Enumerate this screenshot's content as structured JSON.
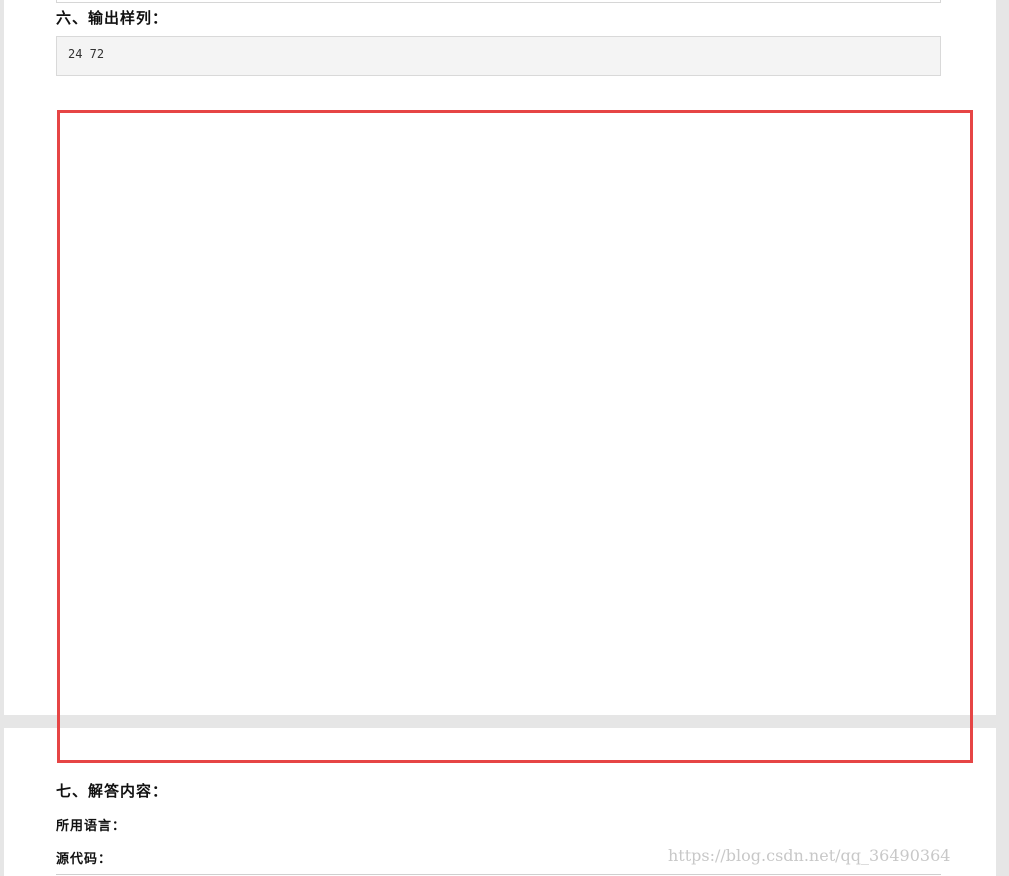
{
  "section_output_sample": {
    "heading": "六、输出样列：",
    "sample_value": "24 72"
  },
  "section_answer": {
    "heading": "七、解答内容：",
    "language_label": "所用语言：",
    "source_label": "源代码："
  },
  "watermark": {
    "text": "https://blog.csdn.net/qq_36490364"
  },
  "colors": {
    "highlight": "#e64545",
    "page_bg": "#e6e6e6",
    "code_bg": "#f4f4f4"
  }
}
